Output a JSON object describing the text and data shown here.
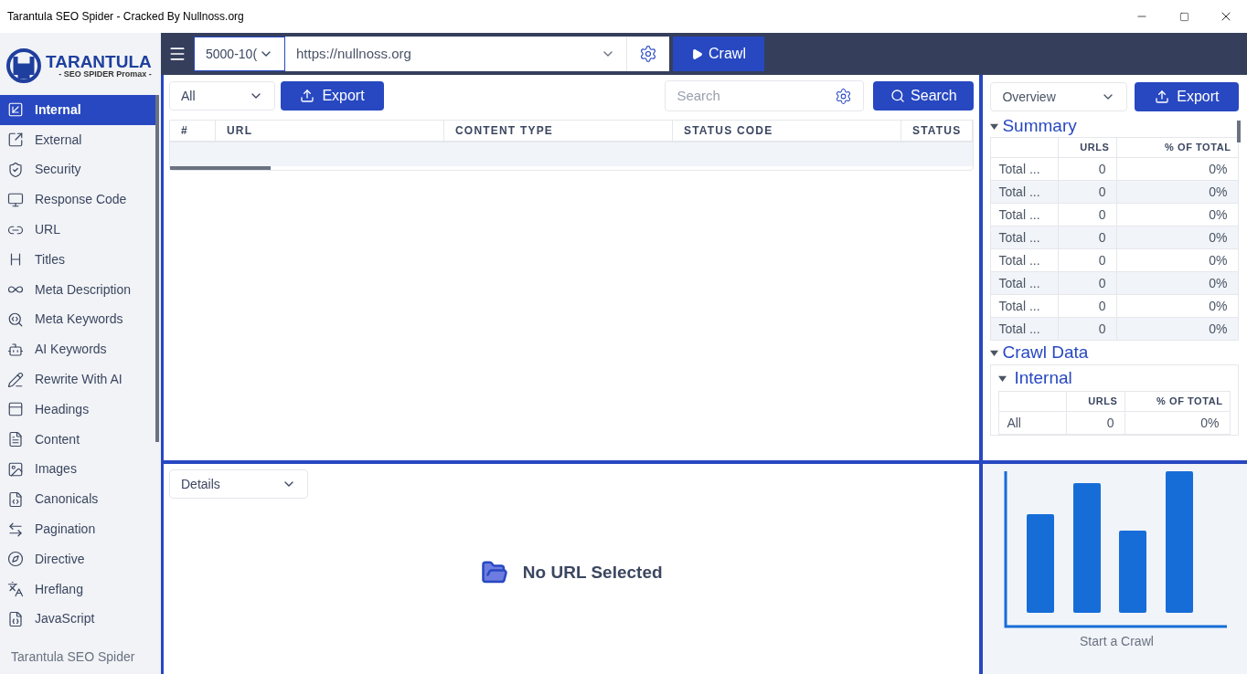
{
  "window": {
    "title": "Tarantula SEO Spider - Cracked By Nullnoss.org"
  },
  "sidebar": {
    "logo": {
      "name": "TARANTULA",
      "tagline": "- SEO SPIDER Promax -"
    },
    "items": [
      {
        "label": "Internal",
        "selected": true
      },
      {
        "label": "External",
        "selected": false
      },
      {
        "label": "Security",
        "selected": false
      },
      {
        "label": "Response Code",
        "selected": false
      },
      {
        "label": "URL",
        "selected": false
      },
      {
        "label": "Titles",
        "selected": false
      },
      {
        "label": "Meta Description",
        "selected": false
      },
      {
        "label": "Meta Keywords",
        "selected": false
      },
      {
        "label": "AI Keywords",
        "selected": false
      },
      {
        "label": "Rewrite With AI",
        "selected": false
      },
      {
        "label": "Headings",
        "selected": false
      },
      {
        "label": "Content",
        "selected": false
      },
      {
        "label": "Images",
        "selected": false
      },
      {
        "label": "Canonicals",
        "selected": false
      },
      {
        "label": "Pagination",
        "selected": false
      },
      {
        "label": "Directive",
        "selected": false
      },
      {
        "label": "Hreflang",
        "selected": false
      },
      {
        "label": "JavaScript",
        "selected": false
      }
    ],
    "footer": "Tarantula SEO Spider"
  },
  "toolbar": {
    "limit": "5000-10(",
    "url": "https://nullnoss.org",
    "crawl_button": "Crawl"
  },
  "results": {
    "filter": "All",
    "export_button": "Export",
    "search": {
      "placeholder": "Search"
    },
    "search_button": "Search",
    "columns": [
      "#",
      "URL",
      "CONTENT TYPE",
      "STATUS CODE",
      "STATUS"
    ]
  },
  "details": {
    "dropdown": "Details",
    "empty_message": "No URL Selected"
  },
  "overview": {
    "dropdown": "Overview",
    "export_button": "Export",
    "summary": {
      "title": "Summary",
      "expanded": true,
      "columns": [
        "URLS",
        "% OF TOTAL"
      ],
      "rows": [
        {
          "label": "Total ...",
          "urls": "0",
          "percent": "0%"
        },
        {
          "label": "Total ...",
          "urls": "0",
          "percent": "0%"
        },
        {
          "label": "Total ...",
          "urls": "0",
          "percent": "0%"
        },
        {
          "label": "Total ...",
          "urls": "0",
          "percent": "0%"
        },
        {
          "label": "Total ...",
          "urls": "0",
          "percent": "0%"
        },
        {
          "label": "Total ...",
          "urls": "0",
          "percent": "0%"
        },
        {
          "label": "Total ...",
          "urls": "0",
          "percent": "0%"
        },
        {
          "label": "Total ...",
          "urls": "0",
          "percent": "0%"
        }
      ]
    },
    "crawl_data": {
      "title": "Crawl Data",
      "expanded": true,
      "sections": [
        {
          "title": "Internal",
          "expanded": true,
          "columns": [
            "URLS",
            "% OF TOTAL"
          ],
          "rows": [
            {
              "label": "All",
              "urls": "0",
              "percent": "0%"
            }
          ]
        }
      ]
    }
  },
  "chart": {
    "caption": "Start a Crawl"
  }
}
